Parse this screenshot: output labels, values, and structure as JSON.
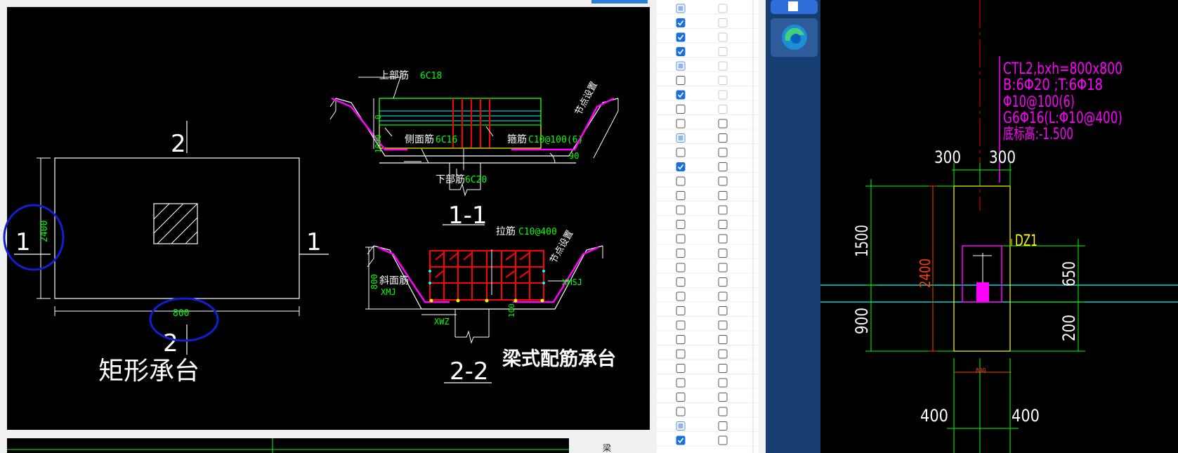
{
  "left_drawing": {
    "label_2_top": "2",
    "label_1_left": "1",
    "label_1_right": "1",
    "label_2_bottom": "2",
    "dim_2400": "2400",
    "dim_800": "800",
    "title": "矩形承台"
  },
  "section_11": {
    "top_rebar_label": "上部筋",
    "top_rebar_value": "6C18",
    "side_rebar_label": "侧面筋",
    "side_rebar_value": "6C16",
    "stirrup_label": "箍筋",
    "stirrup_value": "C10@100(6)",
    "bottom_rebar_label": "下部筋",
    "bottom_rebar_value": "6C20",
    "node_setting": "节点设置",
    "angle_90": "90",
    "dim_0": "0",
    "dim_1000": "1000",
    "section_title": "1-1"
  },
  "section_22": {
    "tie_label": "拉筋",
    "tie_value": "C10@400",
    "node_setting": "节点设置",
    "dim_800": "800",
    "slope_label": "斜面筋",
    "xmj": "XMJ",
    "xmsj": "XMSJ",
    "xwz": "XWZ",
    "dim_100": "100",
    "section_title": "2-2",
    "caption": "梁式配筋承台"
  },
  "checkbox_list": {
    "col1_checked": [
      true,
      true,
      true,
      true,
      true,
      false,
      true,
      false,
      false,
      true,
      false,
      true,
      false,
      false,
      false,
      false,
      false,
      false,
      false,
      false,
      false,
      false,
      false,
      false,
      false,
      false,
      false,
      false,
      false,
      true,
      true
    ],
    "col1_style": [
      "mixed",
      "check",
      "check",
      "check",
      "mixed",
      "none",
      "check",
      "none",
      "none",
      "mixed",
      "none",
      "check",
      "none",
      "none",
      "none",
      "none",
      "none",
      "none",
      "none",
      "none",
      "none",
      "none",
      "none",
      "none",
      "none",
      "none",
      "none",
      "none",
      "none",
      "mixed",
      "check"
    ],
    "bottom_label": "梁"
  },
  "taskbar": {
    "app1_icon": "app-icon",
    "edge_icon": "edge-browser-icon"
  },
  "right_drawing": {
    "annotation_line1": "CTL2,bxh=800x800",
    "annotation_line2": "B:6Φ20 ;T:6Φ18",
    "annotation_line3": "Φ10@100(6)",
    "annotation_line4": "G6Φ16(L:Φ10@400)",
    "annotation_line5": "底标高:-1.500",
    "dim_300_left": "300",
    "dim_300_right": "300",
    "dim_1500": "1500",
    "dim_900": "900",
    "dim_2400": "2400",
    "dz1": "DZ1",
    "dim_650": "650",
    "dim_200": "200",
    "dim_800_small": "800",
    "dim_400_left": "400",
    "dim_400_right": "400"
  },
  "colors": {
    "cad_bg": "#000000",
    "white_line": "#ffffff",
    "green": "#00ff00",
    "cyan": "#00ffff",
    "magenta": "#ff00ff",
    "red": "#ff0000",
    "yellow": "#ffff00",
    "blue_annotation": "#1020d0",
    "taskbar_blue": "#1b4478"
  }
}
